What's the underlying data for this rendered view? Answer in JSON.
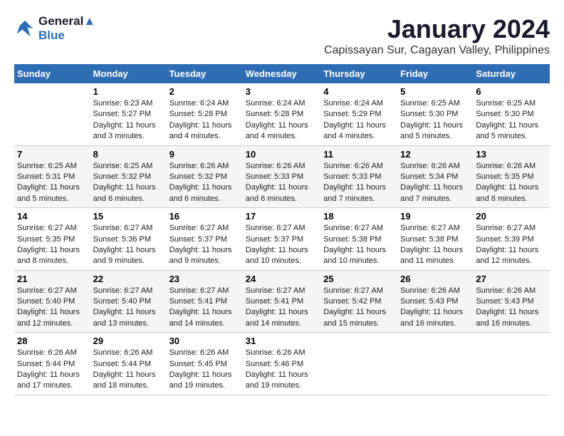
{
  "logo": {
    "line1": "General",
    "line2": "Blue"
  },
  "title": "January 2024",
  "location": "Capissayan Sur, Cagayan Valley, Philippines",
  "days_header": [
    "Sunday",
    "Monday",
    "Tuesday",
    "Wednesday",
    "Thursday",
    "Friday",
    "Saturday"
  ],
  "weeks": [
    [
      {
        "day": "",
        "text": ""
      },
      {
        "day": "1",
        "text": "Sunrise: 6:23 AM\nSunset: 5:27 PM\nDaylight: 11 hours\nand 3 minutes."
      },
      {
        "day": "2",
        "text": "Sunrise: 6:24 AM\nSunset: 5:28 PM\nDaylight: 11 hours\nand 4 minutes."
      },
      {
        "day": "3",
        "text": "Sunrise: 6:24 AM\nSunset: 5:28 PM\nDaylight: 11 hours\nand 4 minutes."
      },
      {
        "day": "4",
        "text": "Sunrise: 6:24 AM\nSunset: 5:29 PM\nDaylight: 11 hours\nand 4 minutes."
      },
      {
        "day": "5",
        "text": "Sunrise: 6:25 AM\nSunset: 5:30 PM\nDaylight: 11 hours\nand 5 minutes."
      },
      {
        "day": "6",
        "text": "Sunrise: 6:25 AM\nSunset: 5:30 PM\nDaylight: 11 hours\nand 5 minutes."
      }
    ],
    [
      {
        "day": "7",
        "text": "Sunrise: 6:25 AM\nSunset: 5:31 PM\nDaylight: 11 hours\nand 5 minutes."
      },
      {
        "day": "8",
        "text": "Sunrise: 6:25 AM\nSunset: 5:32 PM\nDaylight: 11 hours\nand 6 minutes."
      },
      {
        "day": "9",
        "text": "Sunrise: 6:26 AM\nSunset: 5:32 PM\nDaylight: 11 hours\nand 6 minutes."
      },
      {
        "day": "10",
        "text": "Sunrise: 6:26 AM\nSunset: 5:33 PM\nDaylight: 11 hours\nand 6 minutes."
      },
      {
        "day": "11",
        "text": "Sunrise: 6:26 AM\nSunset: 5:33 PM\nDaylight: 11 hours\nand 7 minutes."
      },
      {
        "day": "12",
        "text": "Sunrise: 6:26 AM\nSunset: 5:34 PM\nDaylight: 11 hours\nand 7 minutes."
      },
      {
        "day": "13",
        "text": "Sunrise: 6:26 AM\nSunset: 5:35 PM\nDaylight: 11 hours\nand 8 minutes."
      }
    ],
    [
      {
        "day": "14",
        "text": "Sunrise: 6:27 AM\nSunset: 5:35 PM\nDaylight: 11 hours\nand 8 minutes."
      },
      {
        "day": "15",
        "text": "Sunrise: 6:27 AM\nSunset: 5:36 PM\nDaylight: 11 hours\nand 9 minutes."
      },
      {
        "day": "16",
        "text": "Sunrise: 6:27 AM\nSunset: 5:37 PM\nDaylight: 11 hours\nand 9 minutes."
      },
      {
        "day": "17",
        "text": "Sunrise: 6:27 AM\nSunset: 5:37 PM\nDaylight: 11 hours\nand 10 minutes."
      },
      {
        "day": "18",
        "text": "Sunrise: 6:27 AM\nSunset: 5:38 PM\nDaylight: 11 hours\nand 10 minutes."
      },
      {
        "day": "19",
        "text": "Sunrise: 6:27 AM\nSunset: 5:38 PM\nDaylight: 11 hours\nand 11 minutes."
      },
      {
        "day": "20",
        "text": "Sunrise: 6:27 AM\nSunset: 5:39 PM\nDaylight: 11 hours\nand 12 minutes."
      }
    ],
    [
      {
        "day": "21",
        "text": "Sunrise: 6:27 AM\nSunset: 5:40 PM\nDaylight: 11 hours\nand 12 minutes."
      },
      {
        "day": "22",
        "text": "Sunrise: 6:27 AM\nSunset: 5:40 PM\nDaylight: 11 hours\nand 13 minutes."
      },
      {
        "day": "23",
        "text": "Sunrise: 6:27 AM\nSunset: 5:41 PM\nDaylight: 11 hours\nand 14 minutes."
      },
      {
        "day": "24",
        "text": "Sunrise: 6:27 AM\nSunset: 5:41 PM\nDaylight: 11 hours\nand 14 minutes."
      },
      {
        "day": "25",
        "text": "Sunrise: 6:27 AM\nSunset: 5:42 PM\nDaylight: 11 hours\nand 15 minutes."
      },
      {
        "day": "26",
        "text": "Sunrise: 6:26 AM\nSunset: 5:43 PM\nDaylight: 11 hours\nand 16 minutes."
      },
      {
        "day": "27",
        "text": "Sunrise: 6:26 AM\nSunset: 5:43 PM\nDaylight: 11 hours\nand 16 minutes."
      }
    ],
    [
      {
        "day": "28",
        "text": "Sunrise: 6:26 AM\nSunset: 5:44 PM\nDaylight: 11 hours\nand 17 minutes."
      },
      {
        "day": "29",
        "text": "Sunrise: 6:26 AM\nSunset: 5:44 PM\nDaylight: 11 hours\nand 18 minutes."
      },
      {
        "day": "30",
        "text": "Sunrise: 6:26 AM\nSunset: 5:45 PM\nDaylight: 11 hours\nand 19 minutes."
      },
      {
        "day": "31",
        "text": "Sunrise: 6:26 AM\nSunset: 5:46 PM\nDaylight: 11 hours\nand 19 minutes."
      },
      {
        "day": "",
        "text": ""
      },
      {
        "day": "",
        "text": ""
      },
      {
        "day": "",
        "text": ""
      }
    ]
  ]
}
